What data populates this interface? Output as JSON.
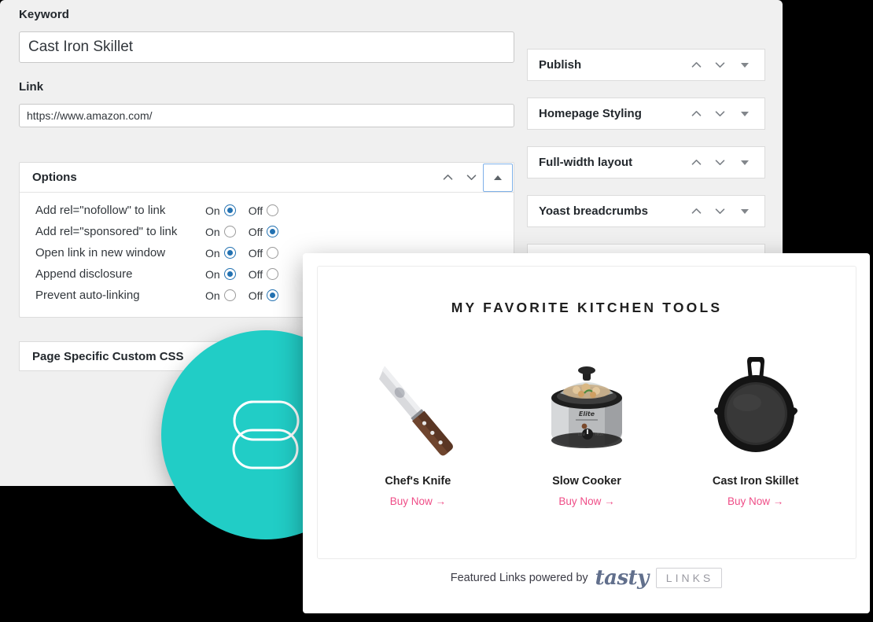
{
  "admin": {
    "keyword": {
      "label": "Keyword",
      "value": "Cast Iron Skillet",
      "placeholder": "Keyword"
    },
    "link": {
      "label": "Link",
      "value": "https://www.amazon.com/",
      "placeholder": "https://"
    },
    "options_box": {
      "title": "Options",
      "collapse_icon": "triangle-up-icon",
      "move_up_icon": "chevron-up-icon",
      "move_down_icon": "chevron-down-icon",
      "rows": [
        {
          "label": "Add rel=\"nofollow\" to link",
          "on_label": "On",
          "off_label": "Off",
          "value": "on"
        },
        {
          "label": "Add rel=\"sponsored\" to link",
          "on_label": "On",
          "off_label": "Off",
          "value": "off"
        },
        {
          "label": "Open link in new window",
          "on_label": "On",
          "off_label": "Off",
          "value": "on"
        },
        {
          "label": "Append disclosure",
          "on_label": "On",
          "off_label": "Off",
          "value": "on"
        },
        {
          "label": "Prevent auto-linking",
          "on_label": "On",
          "off_label": "Off",
          "value": "off"
        }
      ]
    },
    "css_box": {
      "title": "Page Specific Custom CSS"
    },
    "sidebar_boxes": [
      {
        "title": "Publish"
      },
      {
        "title": "Homepage Styling"
      },
      {
        "title": "Full-width layout"
      },
      {
        "title": "Yoast breadcrumbs"
      },
      {
        "title": ""
      }
    ]
  },
  "logo": {
    "icon": "tasty-links-chain-icon",
    "color": "#21cdc6"
  },
  "preview": {
    "title": "MY FAVORITE KITCHEN TOOLS",
    "products": [
      {
        "name": "Chef's Knife",
        "image": "chefs-knife-photo",
        "buy_label": "Buy Now →"
      },
      {
        "name": "Slow Cooker",
        "image": "slow-cooker-photo",
        "buy_label": "Buy Now →"
      },
      {
        "name": "Cast Iron Skillet",
        "image": "cast-iron-skillet-photo",
        "buy_label": "Buy Now →"
      }
    ],
    "footer": {
      "text": "Featured Links powered by",
      "brand_script": "tasty",
      "brand_box": "LINKS"
    },
    "accent_color": "#ef4d87"
  }
}
